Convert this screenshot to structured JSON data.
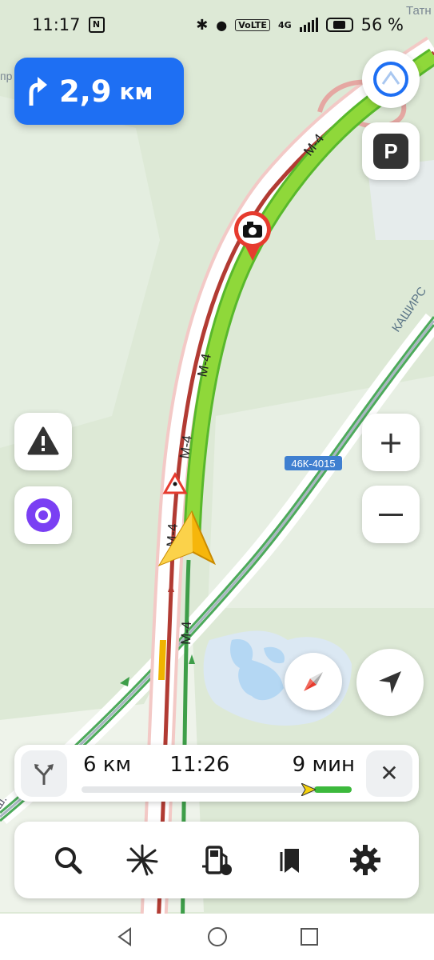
{
  "status_bar": {
    "time": "11:17",
    "volte": "VoLTE",
    "network": "4G",
    "battery_percent": "56 %",
    "battery_level": 0.56
  },
  "map": {
    "top_right_label": "Татн",
    "top_left_label": "пр",
    "road_labels": [
      "М-4",
      "М-4",
      "М-4",
      "М-4",
      "М-4",
      "М-4"
    ],
    "side_road_label": "КАШИРС",
    "road_badge": "46К-4015",
    "bottom_left_label": "ш."
  },
  "maneuver": {
    "distance": "2,9",
    "unit": "км",
    "icon": "turn-right-icon"
  },
  "route_bar": {
    "distance": "6 км",
    "arrival_time": "11:26",
    "duration": "9 мин",
    "remaining_fraction": 0.14
  },
  "toolbar": {
    "items": [
      "search-icon",
      "radar-icon",
      "gas-station-icon",
      "bookmarks-icon",
      "settings-icon"
    ]
  },
  "colors": {
    "accent": "#1e6ff3",
    "route": "#8fd83a",
    "map_bg": "#dde9d6",
    "water": "#b4d7f3",
    "alice": "#7a3ff3",
    "camera": "#e63b2e"
  }
}
